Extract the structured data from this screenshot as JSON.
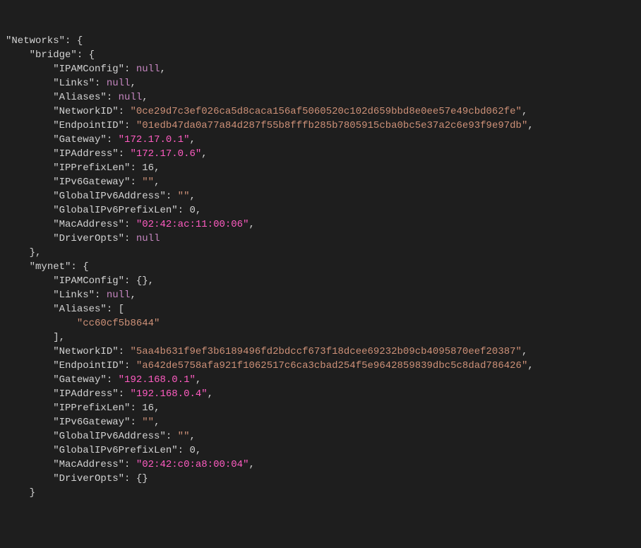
{
  "k_networks": "\"Networks\"",
  "k_bridge": "\"bridge\"",
  "k_ipamconfig": "\"IPAMConfig\"",
  "k_links": "\"Links\"",
  "k_aliases": "\"Aliases\"",
  "k_networkid": "\"NetworkID\"",
  "k_endpointid": "\"EndpointID\"",
  "k_gateway": "\"Gateway\"",
  "k_ipaddress": "\"IPAddress\"",
  "k_ipprefixlen": "\"IPPrefixLen\"",
  "k_ipv6gateway": "\"IPv6Gateway\"",
  "k_globalipv6address": "\"GlobalIPv6Address\"",
  "k_globalipv6prefixlen": "\"GlobalIPv6PrefixLen\"",
  "k_macaddress": "\"MacAddress\"",
  "k_driveropts": "\"DriverOpts\"",
  "k_mynet": "\"mynet\"",
  "v_null": "null",
  "v_bridge_networkid": "\"0ce29d7c3ef026ca5d8caca156af5060520c102d659bbd8e0ee57e49cbd062fe\"",
  "v_bridge_endpointid": "\"01edb47da0a77a84d287f55b8fffb285b7805915cba0bc5e37a2c6e93f9e97db\"",
  "v_bridge_gateway": "\"172.17.0.1\"",
  "v_bridge_ipaddress": "\"172.17.0.6\"",
  "v_bridge_ipprefixlen": "16",
  "v_bridge_ipv6gateway": "\"\"",
  "v_bridge_globalipv6address": "\"\"",
  "v_bridge_globalipv6prefixlen": "0",
  "v_bridge_macaddress": "\"02:42:ac:11:00:06\"",
  "v_mynet_ipamconfig": "{}",
  "v_mynet_alias0": "\"cc60cf5b8644\"",
  "v_mynet_networkid": "\"5aa4b631f9ef3b6189496fd2bdccf673f18dcee69232b09cb4095870eef20387\"",
  "v_mynet_endpointid": "\"a642de5758afa921f1062517c6ca3cbad254f5e9642859839dbc5c8dad786426\"",
  "v_mynet_gateway": "\"192.168.0.1\"",
  "v_mynet_ipaddress": "\"192.168.0.4\"",
  "v_mynet_ipprefixlen": "16",
  "v_mynet_ipv6gateway": "\"\"",
  "v_mynet_globalipv6address": "\"\"",
  "v_mynet_globalipv6prefixlen": "0",
  "v_mynet_macaddress": "\"02:42:c0:a8:00:04\"",
  "v_mynet_driveropts": "{}"
}
